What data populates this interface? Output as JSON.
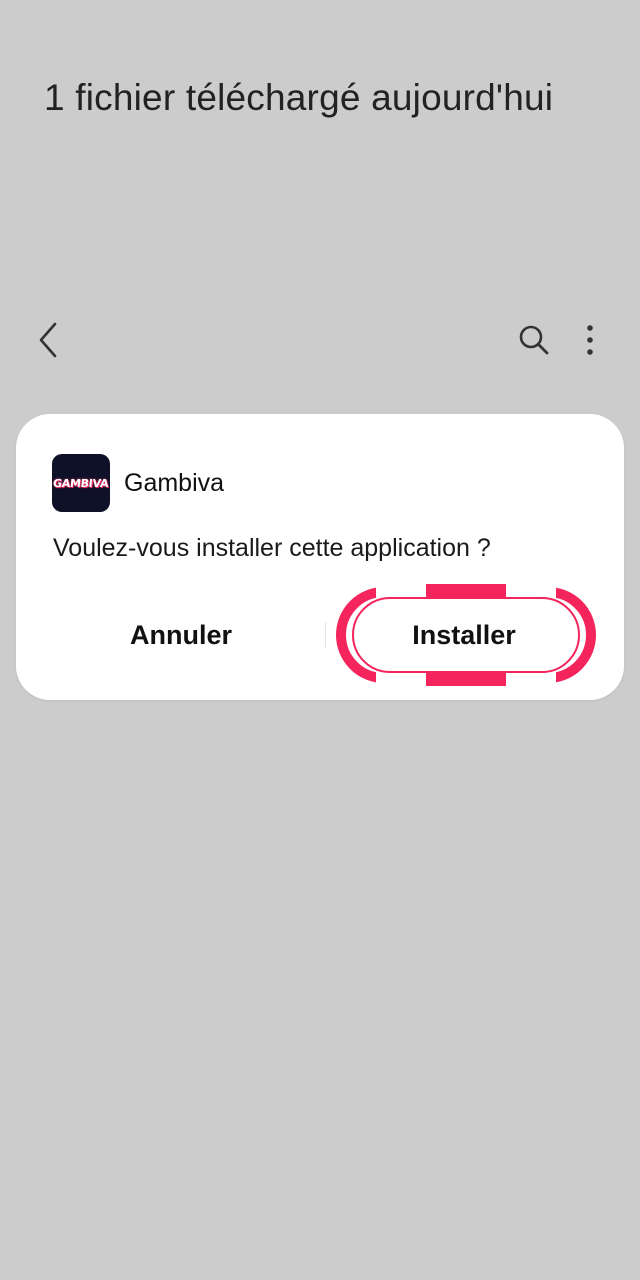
{
  "page": {
    "heading": "1 fichier téléchargé aujourd'hui"
  },
  "toolbar": {
    "back_icon": "chevron-left-icon",
    "search_icon": "search-icon",
    "more_icon": "more-vertical-icon"
  },
  "dialog": {
    "app_icon_text": "GAMBIVA",
    "app_name": "Gambiva",
    "message": "Voulez-vous installer cette application ?",
    "cancel_label": "Annuler",
    "install_label": "Installer"
  },
  "colors": {
    "background": "#cccccc",
    "dialog": "#ffffff",
    "highlight": "#f4245c",
    "app_icon_bg": "#0e1127"
  }
}
